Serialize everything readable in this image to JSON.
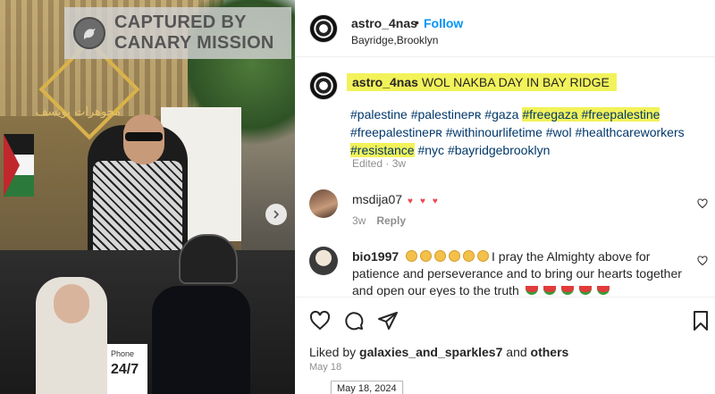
{
  "watermark": {
    "line1": "CAPTURED BY",
    "line2": "CANARY MISSION"
  },
  "media": {
    "arabic_sign": "مجوهرات بويسف",
    "phone_label": "Phone",
    "phone_number": "24/7"
  },
  "header": {
    "username": "astro_4nas",
    "separator": "•",
    "follow_label": "Follow",
    "location": "Bayridge,Brooklyn"
  },
  "caption": {
    "username": "astro_4nas",
    "text": "WOL NAKBA DAY IN BAY RIDGE",
    "tags_line1_a": "#palestine #palestineᴘʀ #gaza ",
    "tags_line1_hl": "#freegaza #freepalestine",
    "tags_line2": "#freepalestineᴘʀ #withinourlifetime #wol #healthcareworkers",
    "tags_line3_hl": "#resistance",
    "tags_line3_b": " #nyc #bayridgebrooklyn",
    "edited": "Edited · 3w"
  },
  "comments": [
    {
      "username": "msdija07",
      "hearts": "♥♥♥",
      "age": "3w",
      "reply_label": "Reply"
    },
    {
      "username": "bio1997",
      "text": "I pray the Almighty above for patience and perseverance and to bring our hearts together and open our eyes to the truth"
    }
  ],
  "likes": {
    "prefix": "Liked by ",
    "user": "galaxies_and_sparkles7",
    "middle": " and ",
    "others": "others"
  },
  "date": "May 18",
  "tooltip": "May 18, 2024",
  "colors": {
    "link": "#00376b",
    "follow": "#0095f6",
    "highlight": "#f2f25a",
    "heart": "#ed4956"
  }
}
